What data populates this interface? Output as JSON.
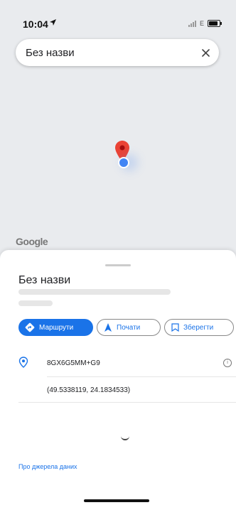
{
  "status_bar": {
    "time": "10:04",
    "network": "E"
  },
  "search": {
    "query": "Без назви"
  },
  "map": {
    "attribution": "Google"
  },
  "place": {
    "title": "Без назви",
    "actions": [
      {
        "label": "Маршрути",
        "icon": "directions-icon"
      },
      {
        "label": "Почати",
        "icon": "navigation-arrow-icon"
      },
      {
        "label": "Зберегти",
        "icon": "bookmark-icon"
      }
    ],
    "plus_code": "8GX6G5MM+G9",
    "coordinates": "(49.5338119, 24.1834533)",
    "data_source_link": "Про джерела даних"
  },
  "colors": {
    "accent": "#1a73e8",
    "pin_red": "#ea4335",
    "map_bg": "#e9ebee"
  }
}
